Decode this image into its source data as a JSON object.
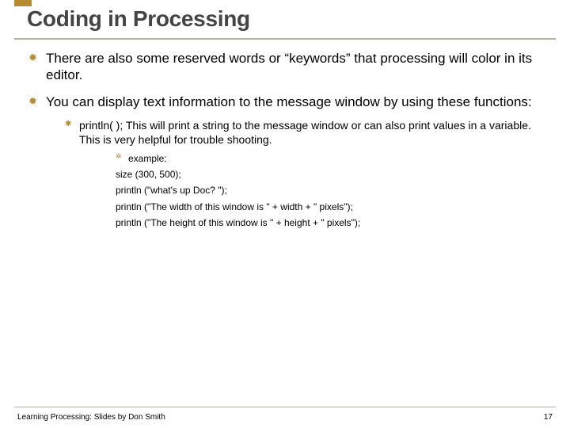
{
  "title": "Coding in Processing",
  "bullets": {
    "b0": "There are also some reserved words or “keywords” that processing will color in its editor.",
    "b1": "You can display text information to the message window by using these functions:",
    "b1_0": "println( ); This will print a string to the message window or can also print values in a variable. This is very helpful for trouble shooting.",
    "b1_0_0": "example:",
    "code0": "size (300, 500);",
    "code1": "println (\"what's up Doc? \");",
    "code2": "println (\"The width of this window is \" + width + \" pixels\");",
    "code3": "println (\"The height of this window is \" + height + \" pixels\");"
  },
  "footer": "Learning Processing:  Slides by Don Smith",
  "page": "17"
}
